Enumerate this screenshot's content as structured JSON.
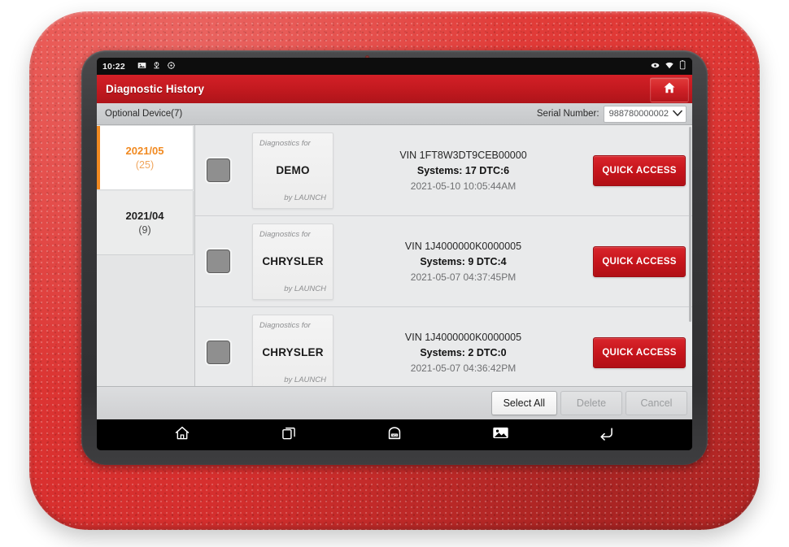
{
  "status_bar": {
    "time": "10:22",
    "left_icons": [
      "image-icon",
      "download-icon",
      "sync-icon"
    ],
    "right_icons": [
      "vci-link-icon",
      "wifi-icon",
      "battery-icon"
    ]
  },
  "app_bar": {
    "title": "Diagnostic History",
    "home_button_icon": "home-icon"
  },
  "sub_bar": {
    "optional_device_label": "Optional Device(7)",
    "serial_label": "Serial Number:",
    "serial_value": "988780000002",
    "dropdown_icon": "chevron-down-icon"
  },
  "sidebar": {
    "items": [
      {
        "month": "2021/05",
        "count": "(25)",
        "selected": true
      },
      {
        "month": "2021/04",
        "count": "(9)",
        "selected": false
      }
    ]
  },
  "records": [
    {
      "card_top": "Diagnostics for",
      "brand": "DEMO",
      "card_bottom": "by LAUNCH",
      "vin": "VIN 1FT8W3DT9CEB00000",
      "systems": "Systems: 17 DTC:6",
      "date": "2021-05-10 10:05:44AM",
      "action_label": "QUICK ACCESS",
      "checked": false
    },
    {
      "card_top": "Diagnostics for",
      "brand": "CHRYSLER",
      "card_bottom": "by LAUNCH",
      "vin": "VIN 1J4000000K0000005",
      "systems": "Systems: 9 DTC:4",
      "date": "2021-05-07 04:37:45PM",
      "action_label": "QUICK ACCESS",
      "checked": false
    },
    {
      "card_top": "Diagnostics for",
      "brand": "CHRYSLER",
      "card_bottom": "by LAUNCH",
      "vin": "VIN 1J4000000K0000005",
      "systems": "Systems: 2 DTC:0",
      "date": "2021-05-07 04:36:42PM",
      "action_label": "QUICK ACCESS",
      "checked": false
    }
  ],
  "action_bar": {
    "select_all": "Select All",
    "delete": "Delete",
    "cancel": "Cancel"
  },
  "nav_bar": {
    "buttons": [
      "home-icon",
      "recents-icon",
      "vci-icon",
      "screenshot-icon",
      "back-icon"
    ]
  },
  "colors": {
    "brand_red": "#c8151c",
    "accent_orange": "#f18a21",
    "case_red": "#d9302f",
    "bezel_dark": "#3a3a3c"
  }
}
